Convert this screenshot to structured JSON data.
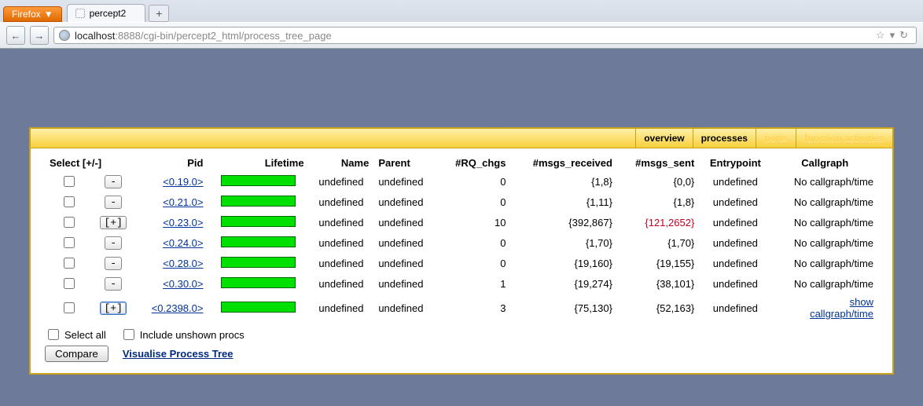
{
  "browser": {
    "app_button": "Firefox",
    "tab_title": "percept2",
    "new_tab": "+",
    "back": "←",
    "forward": "→",
    "url_host": "localhost",
    "url_port": ":8888",
    "url_path": "/cgi-bin/percept2_html/process_tree_page",
    "star": "☆",
    "dropdown": "▾",
    "reload": "↻"
  },
  "topnav": {
    "overview": "overview",
    "processes": "processes",
    "ports": "ports",
    "functions": "function activities"
  },
  "columns": {
    "select": "Select [+/-]",
    "pid": "Pid",
    "lifetime": "Lifetime",
    "name": "Name",
    "parent": "Parent",
    "rq": "#RQ_chgs",
    "recv": "#msgs_received",
    "sent": "#msgs_sent",
    "entry": "Entrypoint",
    "cg": "Callgraph"
  },
  "rows": [
    {
      "pm": "-",
      "pid": "<0.19.0>",
      "name": "undefined",
      "parent": "undefined",
      "rq": "0",
      "recv": "{1,8}",
      "sent": "{0,0}",
      "sent_red": false,
      "entry": "undefined",
      "cg": "No callgraph/time",
      "cg_link": false
    },
    {
      "pm": "-",
      "pid": "<0.21.0>",
      "name": "undefined",
      "parent": "undefined",
      "rq": "0",
      "recv": "{1,11}",
      "sent": "{1,8}",
      "sent_red": false,
      "entry": "undefined",
      "cg": "No callgraph/time",
      "cg_link": false
    },
    {
      "pm": "[+]",
      "pid": "<0.23.0>",
      "name": "undefined",
      "parent": "undefined",
      "rq": "10",
      "recv": "{392,867}",
      "sent": "{121,2652}",
      "sent_red": true,
      "entry": "undefined",
      "cg": "No callgraph/time",
      "cg_link": false
    },
    {
      "pm": "-",
      "pid": "<0.24.0>",
      "name": "undefined",
      "parent": "undefined",
      "rq": "0",
      "recv": "{1,70}",
      "sent": "{1,70}",
      "sent_red": false,
      "entry": "undefined",
      "cg": "No callgraph/time",
      "cg_link": false
    },
    {
      "pm": "-",
      "pid": "<0.28.0>",
      "name": "undefined",
      "parent": "undefined",
      "rq": "0",
      "recv": "{19,160}",
      "sent": "{19,155}",
      "sent_red": false,
      "entry": "undefined",
      "cg": "No callgraph/time",
      "cg_link": false
    },
    {
      "pm": "-",
      "pid": "<0.30.0>",
      "name": "undefined",
      "parent": "undefined",
      "rq": "1",
      "recv": "{19,274}",
      "sent": "{38,101}",
      "sent_red": false,
      "entry": "undefined",
      "cg": "No callgraph/time",
      "cg_link": false
    },
    {
      "pm": "[+]",
      "pm_boxed": true,
      "pid": "<0.2398.0>",
      "name": "undefined",
      "parent": "undefined",
      "rq": "3",
      "recv": "{75,130}",
      "sent": "{52,163}",
      "sent_red": false,
      "entry": "undefined",
      "cg": "show callgraph/time",
      "cg_link": true
    }
  ],
  "footer": {
    "select_all": "Select all",
    "include": "Include unshown procs",
    "compare": "Compare",
    "visualise": "Visualise Process Tree"
  }
}
